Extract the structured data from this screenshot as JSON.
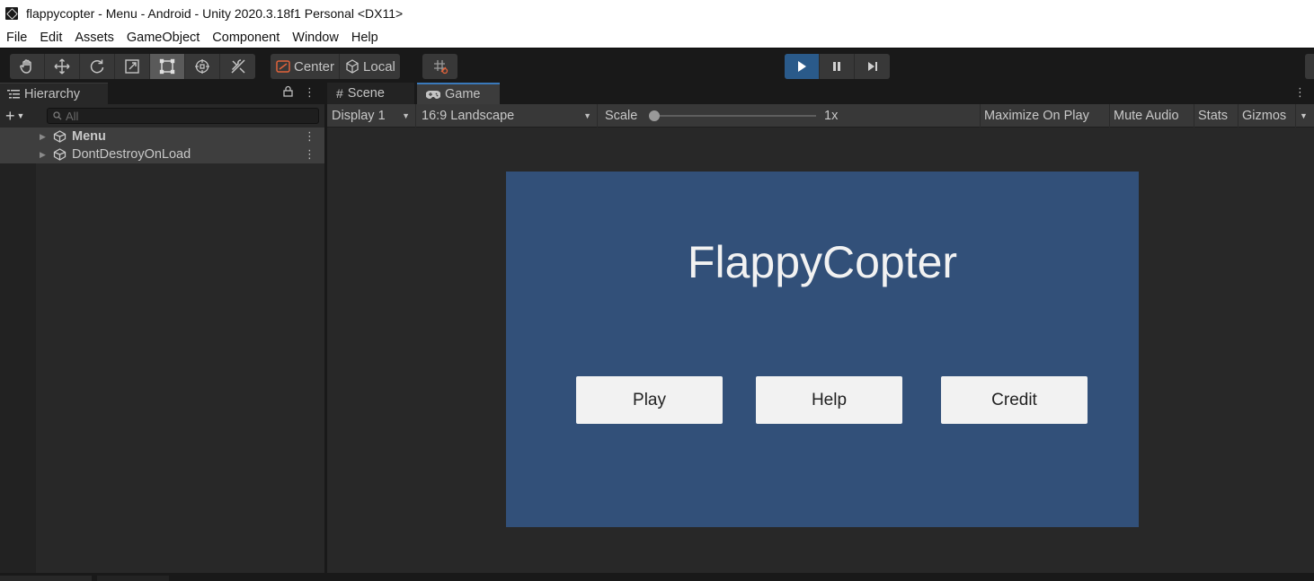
{
  "window": {
    "title": "flappycopter - Menu - Android - Unity 2020.3.18f1 Personal <DX11>"
  },
  "menubar": {
    "items": [
      "File",
      "Edit",
      "Assets",
      "GameObject",
      "Component",
      "Window",
      "Help"
    ]
  },
  "toolbar": {
    "tools": [
      {
        "icon": "hand-tool-icon",
        "active": false
      },
      {
        "icon": "move-tool-icon",
        "active": false
      },
      {
        "icon": "rotate-tool-icon",
        "active": false
      },
      {
        "icon": "scale-tool-icon",
        "active": false
      },
      {
        "icon": "rect-tool-icon",
        "active": true
      },
      {
        "icon": "transform-tool-icon",
        "active": false
      },
      {
        "icon": "custom-tool-icon",
        "active": false
      }
    ],
    "pivot_label": "Center",
    "rotation_label": "Local",
    "play_state": "playing",
    "accent_color": "#3a79bb"
  },
  "hierarchy": {
    "tab_label": "Hierarchy",
    "search_placeholder": "All",
    "rows": [
      {
        "label": "Menu",
        "bold": true
      },
      {
        "label": "DontDestroyOnLoad",
        "bold": false
      }
    ]
  },
  "game_view": {
    "tabs": [
      {
        "label": "Scene",
        "icon": "grid-icon",
        "active": false
      },
      {
        "label": "Game",
        "icon": "gamepad-icon",
        "active": true
      }
    ],
    "display": "Display 1",
    "aspect": "16:9 Landscape",
    "scale_label": "Scale",
    "scale_value": "1x",
    "options": [
      "Maximize On Play",
      "Mute Audio",
      "Stats",
      "Gizmos"
    ]
  },
  "game": {
    "background_color": "#325079",
    "title": "FlappyCopter",
    "buttons": [
      "Play",
      "Help",
      "Credit"
    ]
  }
}
